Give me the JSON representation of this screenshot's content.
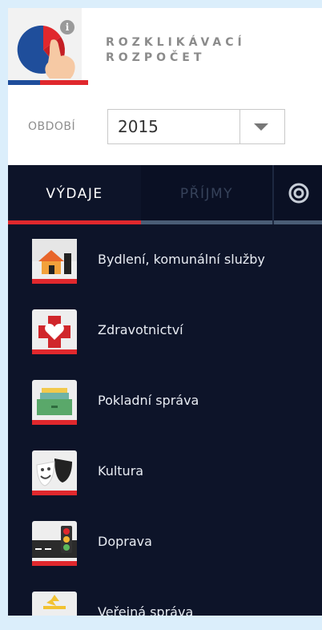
{
  "header": {
    "title_line1": "ROZKLIKÁVACÍ",
    "title_line2": "ROZPOČET"
  },
  "period": {
    "label": "OBDOBÍ",
    "selected_year": "2015"
  },
  "tabs": [
    {
      "label": "VÝDAJE",
      "active": true
    },
    {
      "label": "PŘÍJMY",
      "active": false
    },
    {
      "icon": "target-icon"
    }
  ],
  "categories": [
    {
      "label": "Bydlení, komunální služby",
      "icon": "house-icon"
    },
    {
      "label": "Zdravotnictví",
      "icon": "health-heart-icon"
    },
    {
      "label": "Pokladní správa",
      "icon": "cash-drawer-icon"
    },
    {
      "label": "Kultura",
      "icon": "theatre-masks-icon"
    },
    {
      "label": "Doprava",
      "icon": "traffic-light-icon"
    },
    {
      "label": "Veřejná správa",
      "icon": "public-admin-icon"
    }
  ],
  "colors": {
    "accent_red": "#e0282d",
    "nav_background": "#0d1429",
    "page_background": "#dbeefb"
  }
}
